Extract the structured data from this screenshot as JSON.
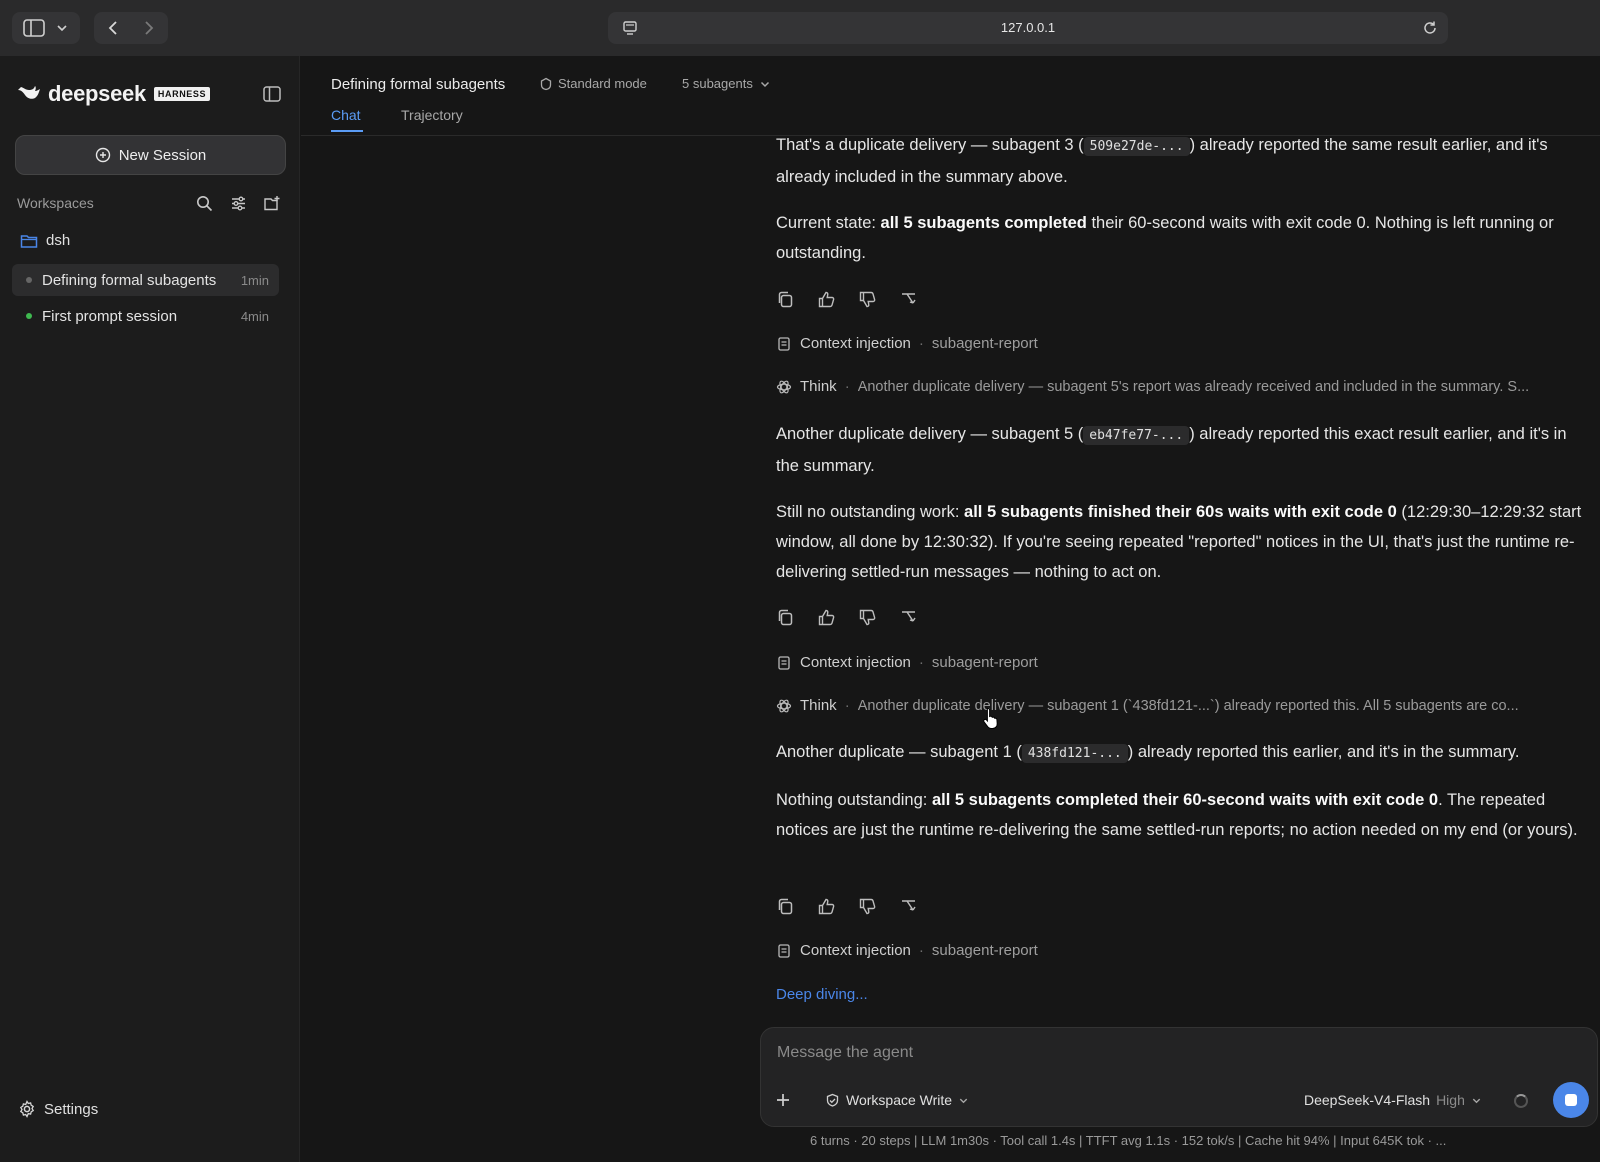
{
  "browser": {
    "url": "127.0.0.1",
    "icons": [
      "sidebar-toggle-icon",
      "chevron-down-icon",
      "back-arrow-icon",
      "forward-arrow-icon",
      "site-info-icon",
      "reload-icon"
    ]
  },
  "sidebar": {
    "logo_text": "deepseek",
    "logo_badge": "HARNESS",
    "new_session_label": "New Session",
    "workspaces_label": "Workspaces",
    "workspace_name": "dsh",
    "sessions": [
      {
        "name": "Defining formal subagents",
        "time": "1min",
        "active": true,
        "status_color": "#666666"
      },
      {
        "name": "First prompt session",
        "time": "4min",
        "active": false,
        "status_color": "#3fb950"
      }
    ],
    "settings_label": "Settings"
  },
  "header": {
    "title": "Defining formal subagents",
    "mode": "Standard mode",
    "subagents": "5 subagents",
    "tabs": [
      "Chat",
      "Trajectory"
    ],
    "active_tab": "Chat"
  },
  "messages": {
    "m1": {
      "p1_pre": "That's a duplicate delivery — subagent 3 (",
      "p1_code": "509e27de-...",
      "p1_post": ") already reported the same result earlier, and it's already included in the summary above.",
      "p2_pre": "Current state: ",
      "p2_bold": "all 5 subagents completed",
      "p2_post": " their 60-second waits with exit code 0. Nothing is left running or outstanding."
    },
    "ctx1": {
      "label": "Context injection",
      "tag": "subagent-report"
    },
    "think1": {
      "label": "Think",
      "text": "Another duplicate delivery — subagent 5's report was already received and included in the summary. S..."
    },
    "m2": {
      "p1_pre": "Another duplicate delivery — subagent 5 (",
      "p1_code": "eb47fe77-...",
      "p1_post": ") already reported this exact result earlier, and it's in the summary.",
      "p2_pre": "Still no outstanding work: ",
      "p2_bold": "all 5 subagents finished their 60s waits with exit code 0",
      "p2_post": " (12:29:30–12:29:32 start window, all done by 12:30:32). If you're seeing repeated \"reported\" notices in the UI, that's just the runtime re-delivering settled-run messages — nothing to act on."
    },
    "ctx2": {
      "label": "Context injection",
      "tag": "subagent-report"
    },
    "think2": {
      "label": "Think",
      "text": "Another duplicate delivery — subagent 1 (`438fd121-...`) already reported this. All 5 subagents are co..."
    },
    "m3": {
      "p1_pre": "Another duplicate — subagent 1 (",
      "p1_code": "438fd121-...",
      "p1_post": ") already reported this earlier, and it's in the summary.",
      "p2_pre": "Nothing outstanding: ",
      "p2_bold": "all 5 subagents completed their 60-second waits with exit code 0",
      "p2_post": ". The repeated notices are just the runtime re-delivering the same settled-run reports; no action needed on my end (or yours)."
    },
    "ctx3": {
      "label": "Context injection",
      "tag": "subagent-report"
    },
    "status": "Deep diving..."
  },
  "composer": {
    "placeholder": "Message the agent",
    "value": "",
    "permission": "Workspace Write",
    "model": "DeepSeek-V4-Flash",
    "effort": "High",
    "accent": "#4a86e8"
  },
  "footer": {
    "stats": "6 turns · 20 steps   |   LLM 1m30s · Tool call 1.4s   |   TTFT avg 1.1s · 152 tok/s   |   Cache hit 94%   |   Input 645K tok · ..."
  }
}
